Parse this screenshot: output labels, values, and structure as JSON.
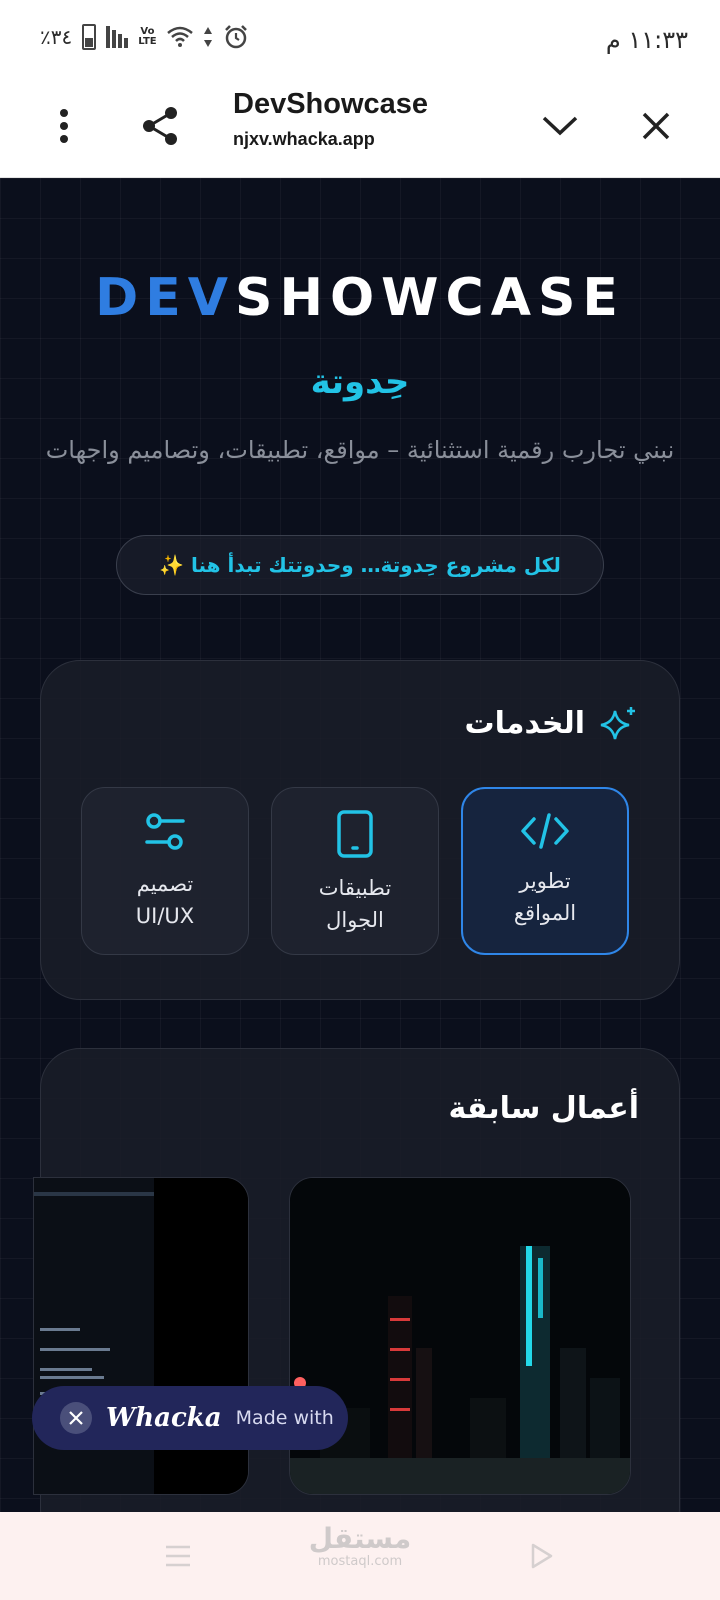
{
  "status_bar": {
    "time": "١١:٣٣ م",
    "battery": "٪٣٤"
  },
  "browser": {
    "title": "DevShowcase",
    "url": "njxv.whacka.app"
  },
  "hero": {
    "brand_part1": "DEV",
    "brand_part2": "SHOWCASE",
    "tagline": "حِدوتة",
    "subtitle": "نبني تجارب رقمية استثنائية – مواقع، تطبيقات، وتصاميم واجهات",
    "pill": "لكل مشروع حِدوتة… وحدوتتك تبدأ هنا ✨"
  },
  "services": {
    "title": "الخدمات",
    "items": [
      {
        "label_line1": "تطوير",
        "label_line2": "المواقع",
        "icon": "code-icon"
      },
      {
        "label_line1": "تطبيقات",
        "label_line2": "الجوال",
        "icon": "smartphone-icon"
      },
      {
        "label_line1": "تصميم",
        "label_line2": "UI/UX",
        "icon": "sliders-icon"
      }
    ]
  },
  "works": {
    "title": "أعمال سابقة"
  },
  "badge": {
    "made_with": "Made with",
    "logo": "Whacka"
  },
  "bottom_bar": {
    "logo_ar": "مستقل",
    "logo_en": "mostaql.com"
  },
  "colors": {
    "accent_blue": "#2f7de1",
    "accent_cyan": "#22c3e6",
    "background": "#0b0f1c"
  }
}
